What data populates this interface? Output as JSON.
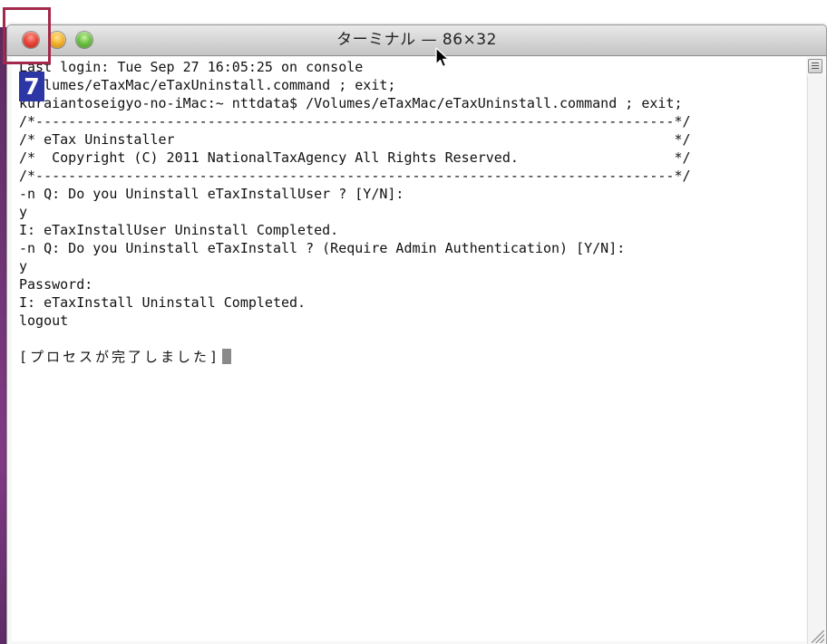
{
  "window": {
    "title": "ターミナル — 86×32",
    "controls": {
      "close_icon": "close-icon",
      "minimize_icon": "minimize-icon",
      "zoom_icon": "zoom-icon"
    }
  },
  "terminal": {
    "lines": [
      "Last login: Tue Sep 27 16:05:25 on console",
      "/Volumes/eTaxMac/eTaxUninstall.command ; exit;",
      "kuraiantoseigyo-no-iMac:~ nttdata$ /Volumes/eTaxMac/eTaxUninstall.command ; exit;",
      "/*------------------------------------------------------------------------------*/",
      "/* eTax Uninstaller                                                             */",
      "/*  Copyright (C) 2011 NationalTaxAgency All Rights Reserved.                   */",
      "/*------------------------------------------------------------------------------*/",
      "-n Q: Do you Uninstall eTaxInstallUser ? [Y/N]:",
      "y",
      "I: eTaxInstallUser Uninstall Completed.",
      "-n Q: Do you Uninstall eTaxInstall ? (Require Admin Authentication) [Y/N]:",
      "y",
      "Password:",
      "I: eTaxInstall Uninstall Completed.",
      "logout",
      "",
      "[プロセスが完了しました]"
    ]
  },
  "annotation": {
    "step_number": "7",
    "highlight_color": "#a3294b",
    "badge_color": "#2c37a5"
  },
  "colors": {
    "close": "#e8463a",
    "minimize": "#f3b52f",
    "zoom": "#6fc245"
  }
}
